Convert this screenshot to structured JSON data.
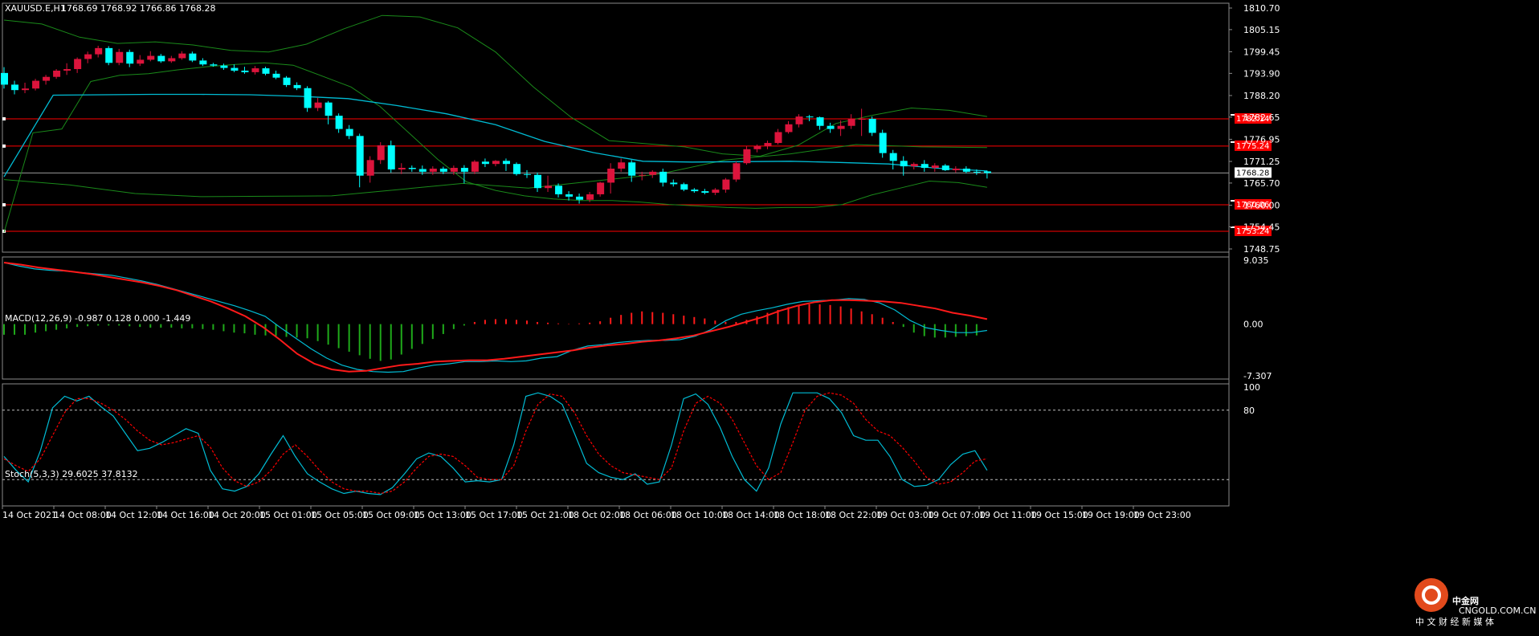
{
  "chart_data": [
    {
      "type": "candlestick",
      "title": "XAUUSD.E,H1",
      "ohlc_label": "1768.69 1768.92 1766.86 1768.28",
      "y_ticks": [
        "1810.70",
        "1805.15",
        "1799.45",
        "1793.90",
        "1788.20",
        "1782.65",
        "1776.95",
        "1771.25",
        "1765.70",
        "1760.00",
        "1754.45",
        "1748.75"
      ],
      "ylim": [
        1748.75,
        1810.7
      ],
      "last_price": "1768.28",
      "hlines": [
        {
          "value": 1782.2,
          "label": "1782.14"
        },
        {
          "value": 1775.2,
          "label": "1775.24"
        },
        {
          "value": 1760.1,
          "label": "1760.06"
        },
        {
          "value": 1753.3,
          "label": "1753.24"
        }
      ],
      "candles": [
        [
          1794.0,
          1795.5,
          1790.0,
          1791.0
        ],
        [
          1791.0,
          1792.0,
          1788.5,
          1789.6
        ],
        [
          1789.6,
          1791.5,
          1788.8,
          1790.0
        ],
        [
          1790.0,
          1792.5,
          1789.5,
          1792.0
        ],
        [
          1792.0,
          1793.5,
          1791.0,
          1793.0
        ],
        [
          1793.0,
          1795.0,
          1792.5,
          1794.6
        ],
        [
          1794.6,
          1796.5,
          1793.5,
          1795.0
        ],
        [
          1795.0,
          1798.0,
          1794.0,
          1797.6
        ],
        [
          1797.6,
          1799.5,
          1796.5,
          1798.8
        ],
        [
          1798.8,
          1801.0,
          1798.0,
          1800.4
        ],
        [
          1800.4,
          1800.9,
          1796.0,
          1796.6
        ],
        [
          1796.6,
          1800.2,
          1796.0,
          1799.4
        ],
        [
          1799.4,
          1800.0,
          1795.5,
          1796.4
        ],
        [
          1796.4,
          1798.6,
          1795.8,
          1797.4
        ],
        [
          1797.4,
          1799.6,
          1797.0,
          1798.4
        ],
        [
          1798.4,
          1798.9,
          1796.6,
          1797.0
        ],
        [
          1797.0,
          1798.4,
          1796.6,
          1797.8
        ],
        [
          1797.8,
          1799.6,
          1797.4,
          1799.0
        ],
        [
          1799.0,
          1799.5,
          1796.8,
          1797.2
        ],
        [
          1797.2,
          1797.8,
          1795.8,
          1796.2
        ],
        [
          1796.2,
          1796.6,
          1795.6,
          1795.9
        ],
        [
          1795.9,
          1796.4,
          1794.8,
          1795.3
        ],
        [
          1795.3,
          1796.2,
          1794.2,
          1794.6
        ],
        [
          1794.6,
          1795.6,
          1793.8,
          1794.2
        ],
        [
          1794.2,
          1795.8,
          1793.6,
          1795.2
        ],
        [
          1795.2,
          1795.6,
          1793.4,
          1793.8
        ],
        [
          1793.8,
          1794.6,
          1792.4,
          1792.8
        ],
        [
          1792.8,
          1793.2,
          1790.4,
          1790.9
        ],
        [
          1790.9,
          1791.6,
          1789.6,
          1790.1
        ],
        [
          1790.1,
          1790.6,
          1784.0,
          1785.0
        ],
        [
          1785.0,
          1787.6,
          1784.2,
          1786.4
        ],
        [
          1786.4,
          1786.8,
          1780.8,
          1783.0
        ],
        [
          1783.0,
          1783.6,
          1778.6,
          1779.6
        ],
        [
          1779.6,
          1780.6,
          1777.0,
          1777.8
        ],
        [
          1777.8,
          1778.4,
          1764.6,
          1767.6
        ],
        [
          1767.6,
          1772.6,
          1765.8,
          1771.6
        ],
        [
          1771.6,
          1776.2,
          1770.6,
          1775.4
        ],
        [
          1775.4,
          1776.6,
          1768.4,
          1769.2
        ],
        [
          1769.2,
          1770.8,
          1768.0,
          1769.6
        ],
        [
          1769.6,
          1770.2,
          1768.6,
          1769.3
        ],
        [
          1769.3,
          1770.2,
          1767.8,
          1768.6
        ],
        [
          1768.6,
          1770.0,
          1767.8,
          1769.4
        ],
        [
          1769.4,
          1769.9,
          1768.0,
          1768.6
        ],
        [
          1768.6,
          1770.2,
          1767.8,
          1769.6
        ],
        [
          1769.6,
          1770.3,
          1765.6,
          1768.6
        ],
        [
          1768.6,
          1771.6,
          1768.0,
          1771.2
        ],
        [
          1771.2,
          1772.0,
          1769.8,
          1770.6
        ],
        [
          1770.6,
          1771.6,
          1770.0,
          1771.4
        ],
        [
          1771.4,
          1772.0,
          1768.8,
          1770.6
        ],
        [
          1770.6,
          1771.0,
          1767.6,
          1768.0
        ],
        [
          1768.0,
          1769.0,
          1767.0,
          1767.8
        ],
        [
          1767.8,
          1768.4,
          1763.4,
          1764.4
        ],
        [
          1764.4,
          1767.6,
          1763.4,
          1765.0
        ],
        [
          1765.0,
          1765.6,
          1762.0,
          1762.8
        ],
        [
          1762.8,
          1763.6,
          1761.2,
          1762.2
        ],
        [
          1762.2,
          1763.0,
          1760.4,
          1761.4
        ],
        [
          1761.4,
          1763.4,
          1760.8,
          1762.8
        ],
        [
          1762.8,
          1766.0,
          1762.2,
          1765.8
        ],
        [
          1765.8,
          1770.8,
          1763.0,
          1769.4
        ],
        [
          1769.4,
          1772.0,
          1768.6,
          1771.0
        ],
        [
          1771.0,
          1771.6,
          1766.0,
          1767.6
        ],
        [
          1767.6,
          1768.6,
          1766.4,
          1767.8
        ],
        [
          1767.8,
          1769.0,
          1767.0,
          1768.6
        ],
        [
          1768.6,
          1769.4,
          1764.8,
          1765.8
        ],
        [
          1765.8,
          1766.6,
          1764.8,
          1765.4
        ],
        [
          1765.4,
          1765.8,
          1763.6,
          1764.0
        ],
        [
          1764.0,
          1764.4,
          1763.2,
          1763.6
        ],
        [
          1763.6,
          1764.2,
          1762.8,
          1763.2
        ],
        [
          1763.2,
          1764.4,
          1762.6,
          1764.0
        ],
        [
          1764.0,
          1767.0,
          1763.2,
          1766.6
        ],
        [
          1766.6,
          1771.2,
          1766.0,
          1770.8
        ],
        [
          1770.8,
          1775.2,
          1770.4,
          1774.4
        ],
        [
          1774.4,
          1775.6,
          1773.6,
          1775.2
        ],
        [
          1775.2,
          1776.6,
          1774.4,
          1776.0
        ],
        [
          1776.0,
          1779.6,
          1775.6,
          1778.8
        ],
        [
          1778.8,
          1781.6,
          1778.4,
          1780.8
        ],
        [
          1780.8,
          1783.4,
          1780.0,
          1782.8
        ],
        [
          1782.8,
          1783.2,
          1781.6,
          1782.6
        ],
        [
          1782.6,
          1782.8,
          1779.4,
          1780.4
        ],
        [
          1780.4,
          1781.2,
          1778.6,
          1779.6
        ],
        [
          1779.6,
          1781.8,
          1777.8,
          1780.4
        ],
        [
          1780.4,
          1783.4,
          1779.6,
          1782.2
        ],
        [
          1782.2,
          1784.8,
          1777.8,
          1782.2
        ],
        [
          1782.2,
          1782.8,
          1777.8,
          1778.6
        ],
        [
          1778.6,
          1779.4,
          1772.2,
          1773.4
        ],
        [
          1773.4,
          1774.2,
          1769.2,
          1771.4
        ],
        [
          1771.4,
          1772.6,
          1767.6,
          1770.0
        ],
        [
          1770.0,
          1771.0,
          1769.2,
          1770.6
        ],
        [
          1770.6,
          1771.6,
          1768.6,
          1769.6
        ],
        [
          1769.6,
          1770.8,
          1768.6,
          1770.2
        ],
        [
          1770.2,
          1770.6,
          1768.8,
          1769.0
        ],
        [
          1769.0,
          1770.0,
          1768.4,
          1769.4
        ],
        [
          1769.4,
          1770.0,
          1768.2,
          1768.6
        ],
        [
          1768.6,
          1769.2,
          1767.8,
          1768.4
        ],
        [
          1768.69,
          1768.92,
          1766.86,
          1768.28
        ]
      ],
      "ma": [
        1767.3,
        1788.3,
        1788.4,
        1788.5,
        1788.5,
        1788.4,
        1788.0,
        1787.4,
        1785.6,
        1783.5,
        1780.7,
        1776.4,
        1773.5,
        1771.3,
        1771.1,
        1771.2,
        1771.3,
        1771.0,
        1770.6,
        1769.5,
        1768.8
      ],
      "bb_upper": [
        1807.6,
        1806.6,
        1803.2,
        1801.6,
        1802.0,
        1801.2,
        1799.8,
        1799.4,
        1801.4,
        1805.4,
        1808.8,
        1808.4,
        1805.6,
        1799.4,
        1790.4,
        1782.6,
        1776.6,
        1775.8,
        1775.0,
        1773.2,
        1772.6,
        1775.4,
        1781.0,
        1783.2,
        1785.0,
        1784.4,
        1782.8
      ],
      "bb_lower": [
        1753.0,
        1778.6,
        1779.6,
        1791.8,
        1793.4,
        1793.8,
        1794.8,
        1795.6,
        1796.2,
        1796.6,
        1796.0,
        1793.2,
        1790.4,
        1785.4,
        1778.6,
        1771.8,
        1766.6,
        1765.2,
        1763.0,
        1762.2,
        1762.3,
        1762.4,
        1764.0,
        1765.6,
        1764.4,
        1766.2,
        1768.0,
        1771.6,
        1773.2,
        1775.6,
        1775.0,
        1774.8
      ],
      "bb_lower_b": [
        1766.0,
        1763.8,
        1762.4,
        1761.6,
        1761.2,
        1761.2,
        1760.8,
        1760.2,
        1759.8,
        1759.4,
        1759.2,
        1759.4,
        1759.4,
        1760.2,
        1762.6,
        1764.4,
        1766.2,
        1765.8,
        1764.6
      ]
    },
    {
      "type": "bar+line",
      "title": "MACD(12,26,9) -0.987 0.128 0.000 -1.449",
      "y_ticks": [
        "9.035",
        "0.00",
        "-7.307"
      ],
      "ylim": [
        -7.307,
        9.035
      ],
      "histogram": [
        -1.5,
        -1.5,
        -1.5,
        -1.2,
        -1.0,
        -0.8,
        -0.6,
        -0.4,
        -0.3,
        -0.2,
        -0.2,
        -0.2,
        -0.3,
        -0.4,
        -0.5,
        -0.5,
        -0.5,
        -0.6,
        -0.6,
        -0.7,
        -0.8,
        -1.0,
        -1.2,
        -1.3,
        -1.5,
        -1.6,
        -1.7,
        -1.8,
        -1.9,
        -2.0,
        -2.4,
        -2.9,
        -3.4,
        -3.9,
        -4.4,
        -4.9,
        -5.2,
        -5.0,
        -4.3,
        -3.5,
        -2.8,
        -2.1,
        -1.4,
        -0.7,
        -0.2,
        0.3,
        0.6,
        0.7,
        0.7,
        0.6,
        0.5,
        0.3,
        0.2,
        0.1,
        0.05,
        0.1,
        0.2,
        0.4,
        0.9,
        1.3,
        1.6,
        1.8,
        1.7,
        1.6,
        1.4,
        1.2,
        1.0,
        0.8,
        0.5,
        0.3,
        0.3,
        0.6,
        1.1,
        1.6,
        2.0,
        2.4,
        2.6,
        2.8,
        2.8,
        2.7,
        2.5,
        2.2,
        1.8,
        1.4,
        0.9,
        0.3,
        -0.4,
        -1.2,
        -1.7,
        -1.9,
        -1.9,
        -1.8,
        -1.7,
        -1.6
      ],
      "macd": [
        8.7,
        8.2,
        7.8,
        7.6,
        7.5,
        7.3,
        7.1,
        6.9,
        6.5,
        6.1,
        5.6,
        5.0,
        4.4,
        3.8,
        3.2,
        2.6,
        1.9,
        1.1,
        -0.5,
        -2.0,
        -3.5,
        -4.8,
        -5.8,
        -6.4,
        -6.7,
        -6.8,
        -6.7,
        -6.2,
        -5.8,
        -5.6,
        -5.3,
        -5.3,
        -5.2,
        -5.3,
        -5.2,
        -4.8,
        -4.6,
        -3.7,
        -3.1,
        -2.9,
        -2.6,
        -2.4,
        -2.3,
        -2.3,
        -2.2,
        -1.7,
        -0.8,
        0.5,
        1.4,
        1.9,
        2.3,
        2.8,
        3.2,
        3.3,
        3.4,
        3.6,
        3.5,
        3.0,
        2.0,
        0.5,
        -0.5,
        -0.9,
        -1.2,
        -1.2,
        -0.9
      ],
      "signal": [
        8.7,
        8.4,
        8.0,
        7.7,
        7.4,
        7.1,
        6.7,
        6.3,
        5.9,
        5.4,
        4.8,
        4.0,
        3.2,
        2.2,
        1.1,
        -0.4,
        -2.2,
        -4.2,
        -5.6,
        -6.4,
        -6.7,
        -6.6,
        -6.2,
        -5.8,
        -5.6,
        -5.3,
        -5.2,
        -5.1,
        -5.1,
        -4.9,
        -4.6,
        -4.3,
        -4.0,
        -3.7,
        -3.3,
        -3.0,
        -2.8,
        -2.5,
        -2.3,
        -2.0,
        -1.6,
        -1.0,
        -0.4,
        0.3,
        1.0,
        1.9,
        2.6,
        3.1,
        3.4,
        3.4,
        3.3,
        3.2,
        3.0,
        2.6,
        2.2,
        1.6,
        1.2,
        0.7
      ]
    },
    {
      "type": "line",
      "title": "Stoch(5,3,3) 29.6025 37.8132",
      "y_ticks": [
        "100",
        "80"
      ],
      "ylim": [
        0,
        100
      ],
      "levels": [
        80,
        20
      ],
      "main": [
        40,
        28,
        18,
        45,
        82,
        92,
        88,
        92,
        83,
        75,
        60,
        45,
        47,
        52,
        58,
        64,
        60,
        28,
        12,
        10,
        14,
        25,
        42,
        58,
        40,
        25,
        18,
        12,
        8,
        10,
        8,
        7,
        13,
        25,
        38,
        43,
        40,
        30,
        18,
        19,
        18,
        20,
        50,
        92,
        95,
        92,
        85,
        60,
        34,
        26,
        22,
        20,
        25,
        16,
        18,
        50,
        90,
        94,
        85,
        65,
        40,
        20,
        10,
        30,
        68,
        95,
        95,
        95,
        90,
        78,
        58,
        54,
        54,
        40,
        20,
        14,
        15,
        20,
        33,
        42,
        45,
        28
      ],
      "signal": [
        38,
        32,
        27,
        38,
        58,
        78,
        90,
        90,
        86,
        80,
        72,
        62,
        54,
        50,
        52,
        55,
        58,
        48,
        30,
        19,
        14,
        18,
        28,
        42,
        50,
        40,
        28,
        18,
        12,
        10,
        10,
        8,
        10,
        18,
        30,
        40,
        42,
        40,
        32,
        22,
        20,
        20,
        32,
        62,
        85,
        94,
        92,
        78,
        58,
        42,
        32,
        26,
        24,
        22,
        20,
        30,
        62,
        86,
        92,
        86,
        72,
        52,
        32,
        20,
        26,
        52,
        80,
        92,
        95,
        93,
        86,
        72,
        62,
        58,
        48,
        36,
        22,
        16,
        18,
        26,
        36,
        38
      ]
    },
    {
      "type": "time_axis",
      "x_ticks": [
        "14 Oct 2021",
        "14 Oct 08:00",
        "14 Oct 12:00",
        "14 Oct 16:00",
        "14 Oct 20:00",
        "15 Oct 01:00",
        "15 Oct 05:00",
        "15 Oct 09:00",
        "15 Oct 13:00",
        "15 Oct 17:00",
        "15 Oct 21:00",
        "18 Oct 02:00",
        "18 Oct 06:00",
        "18 Oct 10:00",
        "18 Oct 14:00",
        "18 Oct 18:00",
        "18 Oct 22:00",
        "19 Oct 03:00",
        "19 Oct 07:00",
        "19 Oct 11:00",
        "19 Oct 15:00",
        "19 Oct 19:00",
        "19 Oct 23:00"
      ]
    }
  ],
  "watermark": {
    "brand": "中金网",
    "url": "CNGOLD.COM.CN",
    "tagline": "中 文 财 经 新 媒 体"
  },
  "colors": {
    "bull": "#00ffff",
    "bear": "#dc143c",
    "bb": "#1a8a1a",
    "ma": "#00bcd4",
    "hline": "#ff0000",
    "macd_line": "#ff1a1a",
    "hist_neg": "#1faa1a",
    "hist_pos": "#ff1a1a"
  }
}
